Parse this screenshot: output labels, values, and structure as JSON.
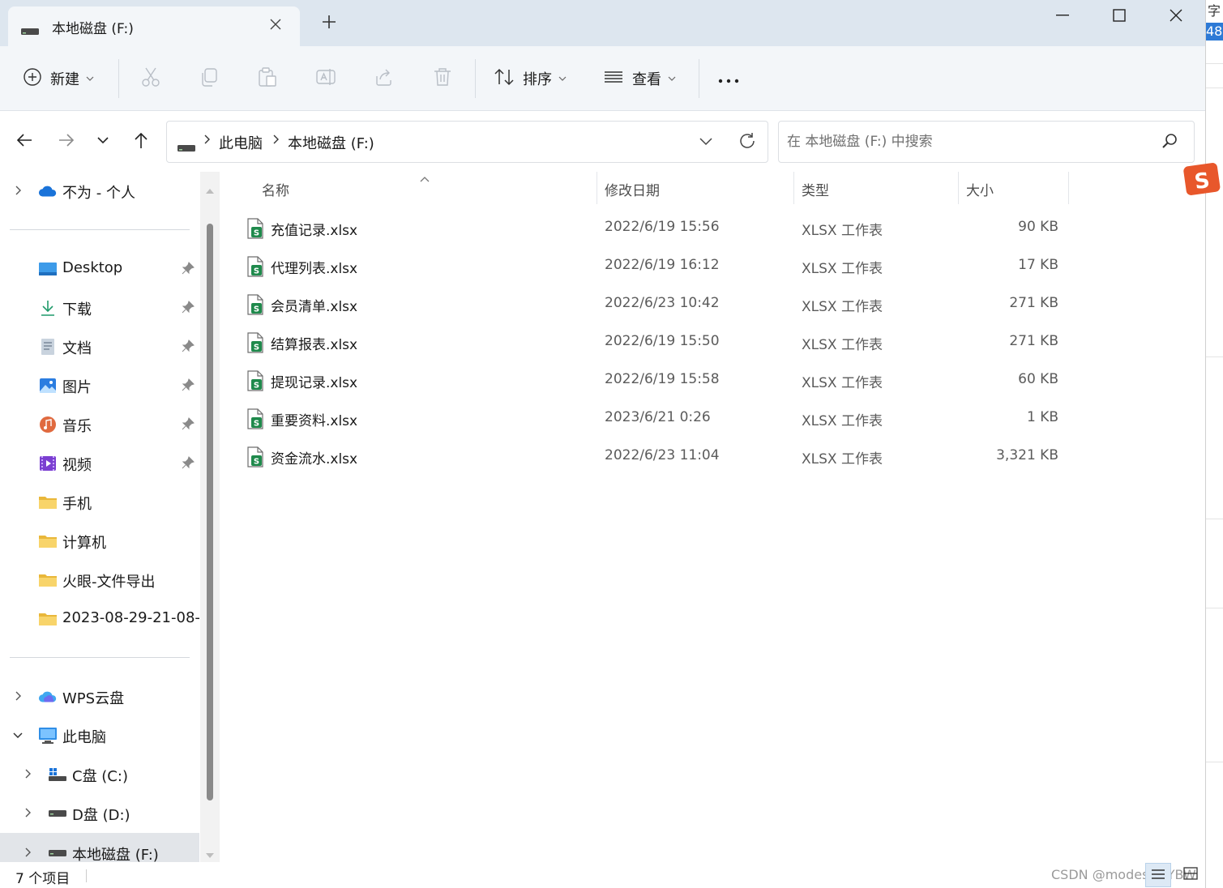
{
  "window": {
    "tab_title": "本地磁盘 (F:)",
    "new_tab_icon": "plus-icon",
    "controls": [
      "minimize-icon",
      "maximize-icon",
      "close-icon"
    ]
  },
  "toolbar": {
    "new_label": "新建",
    "sort_label": "排序",
    "view_label": "查看",
    "icons": [
      "new-icon",
      "cut-icon",
      "copy-icon",
      "paste-icon",
      "rename-icon",
      "share-icon",
      "delete-icon",
      "sort-icon",
      "view-icon",
      "more-icon"
    ]
  },
  "address": {
    "breadcrumbs": [
      "此电脑",
      "本地磁盘 (F:)"
    ],
    "search_placeholder": "在 本地磁盘 (F:) 中搜索"
  },
  "sidebar": {
    "items": [
      {
        "label": "不为 - 个人",
        "icon": "onedrive-cloud-icon"
      },
      {
        "label": "Desktop",
        "icon": "desktop-icon",
        "pinned": true
      },
      {
        "label": "下载",
        "icon": "download-icon",
        "pinned": true
      },
      {
        "label": "文档",
        "icon": "document-icon",
        "pinned": true
      },
      {
        "label": "图片",
        "icon": "pictures-icon",
        "pinned": true
      },
      {
        "label": "音乐",
        "icon": "music-icon",
        "pinned": true
      },
      {
        "label": "视频",
        "icon": "video-icon",
        "pinned": true
      },
      {
        "label": "手机",
        "icon": "folder-icon"
      },
      {
        "label": "计算机",
        "icon": "folder-icon"
      },
      {
        "label": "火眼-文件导出",
        "icon": "folder-icon"
      },
      {
        "label": "2023-08-29-21-08-",
        "icon": "folder-icon"
      },
      {
        "label": "WPS云盘",
        "icon": "wps-cloud-icon"
      },
      {
        "label": "此电脑",
        "icon": "this-pc-icon"
      },
      {
        "label": "C盘 (C:)",
        "icon": "windows-drive-icon"
      },
      {
        "label": "D盘 (D:)",
        "icon": "drive-icon"
      },
      {
        "label": "本地磁盘 (F:)",
        "icon": "drive-icon",
        "selected": true
      }
    ]
  },
  "file_list": {
    "columns": {
      "name": "名称",
      "date": "修改日期",
      "type": "类型",
      "size": "大小"
    },
    "sort_column": "name",
    "rows": [
      {
        "name": "充值记录.xlsx",
        "date": "2022/6/19 15:56",
        "type": "XLSX 工作表",
        "size": "90 KB"
      },
      {
        "name": "代理列表.xlsx",
        "date": "2022/6/19 16:12",
        "type": "XLSX 工作表",
        "size": "17 KB"
      },
      {
        "name": "会员清单.xlsx",
        "date": "2022/6/23 10:42",
        "type": "XLSX 工作表",
        "size": "271 KB"
      },
      {
        "name": "结算报表.xlsx",
        "date": "2022/6/19 15:50",
        "type": "XLSX 工作表",
        "size": "271 KB"
      },
      {
        "name": "提现记录.xlsx",
        "date": "2022/6/19 15:58",
        "type": "XLSX 工作表",
        "size": "60 KB"
      },
      {
        "name": "重要资料.xlsx",
        "date": "2023/6/21 0:26",
        "type": "XLSX 工作表",
        "size": "1 KB"
      },
      {
        "name": "资金流水.xlsx",
        "date": "2022/6/23 11:04",
        "type": "XLSX 工作表",
        "size": "3,321 KB"
      }
    ]
  },
  "status": {
    "item_count": "7 个项目",
    "watermark": "CSDN @modest—YBW"
  },
  "background_app": {
    "char": "字",
    "number": "48"
  },
  "colors": {
    "titlebar_bg": "#dde6ef",
    "toolbar_bg": "#f3f6f9",
    "selected_bg": "#e2e5e9",
    "xlsx_green": "#1f8a4c",
    "folder_yellow": "#f5c542"
  }
}
